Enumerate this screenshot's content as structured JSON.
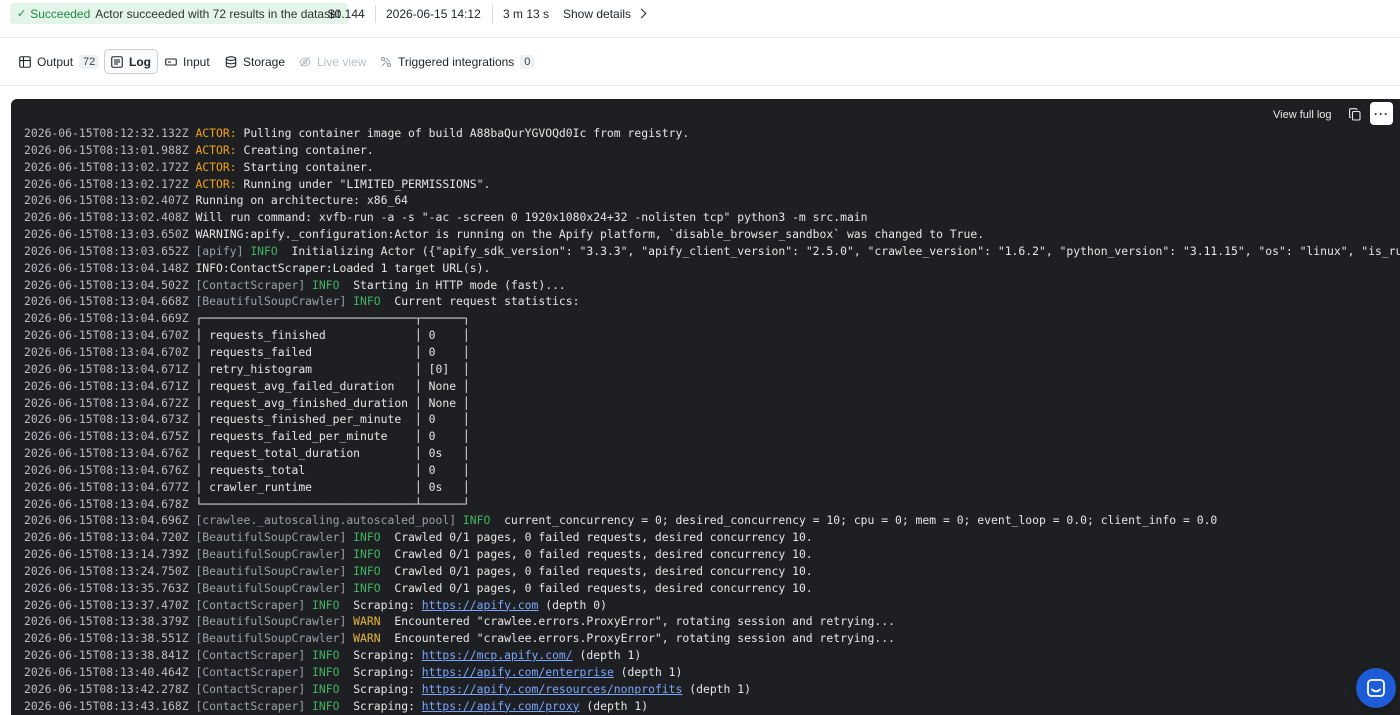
{
  "run": {
    "status": "Succeeded",
    "message": "Actor succeeded with 72 results in the dataset",
    "cost": "$0.144",
    "started": "2026-06-15 14:12",
    "duration": "3 m 13 s",
    "details_label": "Show details"
  },
  "tabs": [
    {
      "label": "Output",
      "count": "72",
      "icon": "table-icon",
      "active": false,
      "disabled": false
    },
    {
      "label": "Log",
      "icon": "log-icon",
      "active": true,
      "disabled": false
    },
    {
      "label": "Input",
      "icon": "input-icon",
      "active": false,
      "disabled": false
    },
    {
      "label": "Storage",
      "icon": "storage-icon",
      "active": false,
      "disabled": false
    },
    {
      "label": "Live view",
      "icon": "live-view-icon",
      "active": false,
      "disabled": true
    },
    {
      "label": "Triggered integrations",
      "count": "0",
      "icon": "integrations-icon",
      "active": false,
      "disabled": false
    }
  ],
  "log": {
    "full_log_label": "View full log",
    "lines": [
      {
        "ts": "2026-06-15T08:12:32.132Z",
        "parts": [
          {
            "t": "ACTOR:",
            "c": "actor"
          },
          {
            "t": " Pulling container image of build A88baQurYGVOQd0Ic from registry."
          }
        ]
      },
      {
        "ts": "2026-06-15T08:13:01.988Z",
        "parts": [
          {
            "t": "ACTOR:",
            "c": "actor"
          },
          {
            "t": " Creating container."
          }
        ]
      },
      {
        "ts": "2026-06-15T08:13:02.172Z",
        "parts": [
          {
            "t": "ACTOR:",
            "c": "actor"
          },
          {
            "t": " Starting container."
          }
        ]
      },
      {
        "ts": "2026-06-15T08:13:02.172Z",
        "parts": [
          {
            "t": "ACTOR:",
            "c": "actor"
          },
          {
            "t": " Running under \"LIMITED_PERMISSIONS\"."
          }
        ]
      },
      {
        "ts": "2026-06-15T08:13:02.407Z",
        "parts": [
          {
            "t": "Running on architecture: x86_64"
          }
        ]
      },
      {
        "ts": "2026-06-15T08:13:02.408Z",
        "parts": [
          {
            "t": "Will run command: xvfb-run -a -s \"-ac -screen 0 1920x1080x24+32 -nolisten tcp\" python3 -m src.main"
          }
        ]
      },
      {
        "ts": "2026-06-15T08:13:03.650Z",
        "parts": [
          {
            "t": "WARNING:apify._configuration:Actor is running on the Apify platform, `disable_browser_sandbox` was changed to True."
          }
        ]
      },
      {
        "ts": "2026-06-15T08:13:03.652Z",
        "parts": [
          {
            "t": "[apify]",
            "c": "src"
          },
          {
            "t": " INFO ",
            "c": "info"
          },
          {
            "t": " Initializing Actor ({\"apify_sdk_version\": \"3.3.3\", \"apify_client_version\": \"2.5.0\", \"crawlee_version\": \"1.6.2\", \"python_version\": \"3.11.15\", \"os\": \"linux\", \"is_running_in_ip"
          }
        ]
      },
      {
        "ts": "2026-06-15T08:13:04.148Z",
        "parts": [
          {
            "t": "INFO:ContactScraper:Loaded 1 target URL(s)."
          }
        ]
      },
      {
        "ts": "2026-06-15T08:13:04.502Z",
        "parts": [
          {
            "t": "[ContactScraper]",
            "c": "src"
          },
          {
            "t": " INFO ",
            "c": "info"
          },
          {
            "t": " Starting in HTTP mode (fast)..."
          }
        ]
      },
      {
        "ts": "2026-06-15T08:13:04.668Z",
        "parts": [
          {
            "t": "[BeautifulSoupCrawler]",
            "c": "src"
          },
          {
            "t": " INFO ",
            "c": "info"
          },
          {
            "t": " Current request statistics:"
          }
        ]
      },
      {
        "ts": "2026-06-15T08:13:04.669Z",
        "parts": [
          {
            "t": "┌───────────────────────────────┬──────┐"
          }
        ]
      },
      {
        "ts": "2026-06-15T08:13:04.670Z",
        "parts": [
          {
            "t": "│ requests_finished             │ 0    │"
          }
        ]
      },
      {
        "ts": "2026-06-15T08:13:04.670Z",
        "parts": [
          {
            "t": "│ requests_failed               │ 0    │"
          }
        ]
      },
      {
        "ts": "2026-06-15T08:13:04.671Z",
        "parts": [
          {
            "t": "│ retry_histogram               │ [0]  │"
          }
        ]
      },
      {
        "ts": "2026-06-15T08:13:04.671Z",
        "parts": [
          {
            "t": "│ request_avg_failed_duration   │ None │"
          }
        ]
      },
      {
        "ts": "2026-06-15T08:13:04.672Z",
        "parts": [
          {
            "t": "│ request_avg_finished_duration │ None │"
          }
        ]
      },
      {
        "ts": "2026-06-15T08:13:04.673Z",
        "parts": [
          {
            "t": "│ requests_finished_per_minute  │ 0    │"
          }
        ]
      },
      {
        "ts": "2026-06-15T08:13:04.675Z",
        "parts": [
          {
            "t": "│ requests_failed_per_minute    │ 0    │"
          }
        ]
      },
      {
        "ts": "2026-06-15T08:13:04.676Z",
        "parts": [
          {
            "t": "│ request_total_duration        │ 0s   │"
          }
        ]
      },
      {
        "ts": "2026-06-15T08:13:04.676Z",
        "parts": [
          {
            "t": "│ requests_total                │ 0    │"
          }
        ]
      },
      {
        "ts": "2026-06-15T08:13:04.677Z",
        "parts": [
          {
            "t": "│ crawler_runtime               │ 0s   │"
          }
        ]
      },
      {
        "ts": "2026-06-15T08:13:04.678Z",
        "parts": [
          {
            "t": "└───────────────────────────────┴──────┘"
          }
        ]
      },
      {
        "ts": "2026-06-15T08:13:04.696Z",
        "parts": [
          {
            "t": "[crawlee._autoscaling.autoscaled_pool]",
            "c": "src"
          },
          {
            "t": " INFO ",
            "c": "info"
          },
          {
            "t": " current_concurrency = 0; desired_concurrency = 10; cpu = 0; mem = 0; event_loop = 0.0; client_info = 0.0"
          }
        ]
      },
      {
        "ts": "2026-06-15T08:13:04.720Z",
        "parts": [
          {
            "t": "[BeautifulSoupCrawler]",
            "c": "src"
          },
          {
            "t": " INFO ",
            "c": "info"
          },
          {
            "t": " Crawled 0/1 pages, 0 failed requests, desired concurrency 10."
          }
        ]
      },
      {
        "ts": "2026-06-15T08:13:14.739Z",
        "parts": [
          {
            "t": "[BeautifulSoupCrawler]",
            "c": "src"
          },
          {
            "t": " INFO ",
            "c": "info"
          },
          {
            "t": " Crawled 0/1 pages, 0 failed requests, desired concurrency 10."
          }
        ]
      },
      {
        "ts": "2026-06-15T08:13:24.750Z",
        "parts": [
          {
            "t": "[BeautifulSoupCrawler]",
            "c": "src"
          },
          {
            "t": " INFO ",
            "c": "info"
          },
          {
            "t": " Crawled 0/1 pages, 0 failed requests, desired concurrency 10."
          }
        ]
      },
      {
        "ts": "2026-06-15T08:13:35.763Z",
        "parts": [
          {
            "t": "[BeautifulSoupCrawler]",
            "c": "src"
          },
          {
            "t": " INFO ",
            "c": "info"
          },
          {
            "t": " Crawled 0/1 pages, 0 failed requests, desired concurrency 10."
          }
        ]
      },
      {
        "ts": "2026-06-15T08:13:37.470Z",
        "parts": [
          {
            "t": "[ContactScraper]",
            "c": "src"
          },
          {
            "t": " INFO ",
            "c": "info"
          },
          {
            "t": " Scraping: "
          },
          {
            "t": "https://apify.com",
            "c": "link"
          },
          {
            "t": " (depth 0)"
          }
        ]
      },
      {
        "ts": "2026-06-15T08:13:38.379Z",
        "parts": [
          {
            "t": "[BeautifulSoupCrawler]",
            "c": "src"
          },
          {
            "t": " WARN ",
            "c": "warn"
          },
          {
            "t": " Encountered \"crawlee.errors.ProxyError\", rotating session and retrying..."
          }
        ]
      },
      {
        "ts": "2026-06-15T08:13:38.551Z",
        "parts": [
          {
            "t": "[BeautifulSoupCrawler]",
            "c": "src"
          },
          {
            "t": " WARN ",
            "c": "warn"
          },
          {
            "t": " Encountered \"crawlee.errors.ProxyError\", rotating session and retrying..."
          }
        ]
      },
      {
        "ts": "2026-06-15T08:13:38.841Z",
        "parts": [
          {
            "t": "[ContactScraper]",
            "c": "src"
          },
          {
            "t": " INFO ",
            "c": "info"
          },
          {
            "t": " Scraping: "
          },
          {
            "t": "https://mcp.apify.com/",
            "c": "link"
          },
          {
            "t": " (depth 1)"
          }
        ]
      },
      {
        "ts": "2026-06-15T08:13:40.464Z",
        "parts": [
          {
            "t": "[ContactScraper]",
            "c": "src"
          },
          {
            "t": " INFO ",
            "c": "info"
          },
          {
            "t": " Scraping: "
          },
          {
            "t": "https://apify.com/enterprise",
            "c": "link"
          },
          {
            "t": " (depth 1)"
          }
        ]
      },
      {
        "ts": "2026-06-15T08:13:42.278Z",
        "parts": [
          {
            "t": "[ContactScraper]",
            "c": "src"
          },
          {
            "t": " INFO ",
            "c": "info"
          },
          {
            "t": " Scraping: "
          },
          {
            "t": "https://apify.com/resources/nonprofits",
            "c": "link"
          },
          {
            "t": " (depth 1)"
          }
        ]
      },
      {
        "ts": "2026-06-15T08:13:43.168Z",
        "parts": [
          {
            "t": "[ContactScraper]",
            "c": "src"
          },
          {
            "t": " INFO ",
            "c": "info"
          },
          {
            "t": " Scraping: "
          },
          {
            "t": "https://apify.com/proxy",
            "c": "link"
          },
          {
            "t": " (depth 1)"
          }
        ]
      }
    ]
  },
  "colors": {
    "success": "#1d8a47",
    "log_bg": "#1e1f22",
    "actor": "#f0a21a",
    "info": "#3fb460",
    "warn": "#e7b53a",
    "link": "#7aa7ff",
    "chat": "#1e5bd6"
  }
}
